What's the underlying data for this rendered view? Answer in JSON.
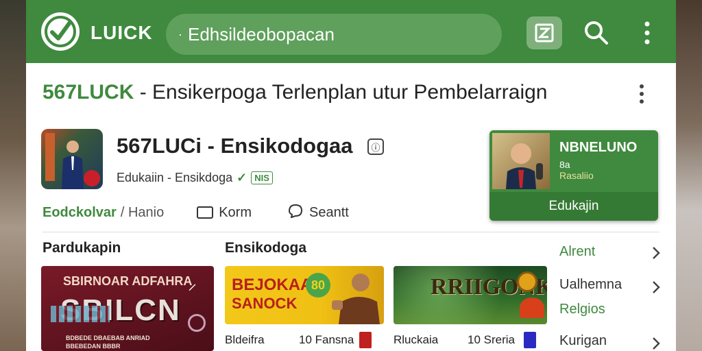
{
  "app": {
    "brand": "LUICK"
  },
  "search": {
    "value": "Edhsildeobopacan"
  },
  "page": {
    "heading_brand": "567LUCK",
    "heading_rest": " - Ensikerpoga Terlenplan utur Pembelarraign"
  },
  "app_row": {
    "title": "567LUCi - Ensikodogaa",
    "subtitle": "Edukaiin - Ensikdoga",
    "badge": "NIS",
    "actions": [
      {
        "label": "Eodckolvar",
        "extra": "/ Hanio"
      },
      {
        "label": "Korm"
      },
      {
        "label": "Seantt"
      }
    ]
  },
  "featured": {
    "title": "NBNELUNO",
    "sub1": "8a",
    "sub2": "Rasaliio",
    "bar_label": "Edukajin"
  },
  "sections": {
    "left": "Pardukapin",
    "mid": "Ensikodoga"
  },
  "cards": [
    {
      "line1": "SBIRNOAR ADFAHRA",
      "line2": "SBILCN",
      "line3": "BDBEDE DBAEBAB ANRIAD",
      "line4": "BBEBEDAN BBBR"
    },
    {
      "line1": "BEJOKAAN",
      "line2": "SANOCK",
      "line3": "80"
    },
    {
      "line1": "RRIIGONK"
    }
  ],
  "card_meta": [
    {
      "title": "Bldeifra",
      "count": "10 Fansna"
    },
    {
      "title": "Rluckaia",
      "count": "10 Sreria"
    }
  ],
  "right_list": [
    "Alrent",
    "Ualhemna",
    "Relgios",
    "Kurigan"
  ],
  "colors": {
    "brand_green": "#3f8a3e",
    "topbar": "#3f8a3e"
  }
}
